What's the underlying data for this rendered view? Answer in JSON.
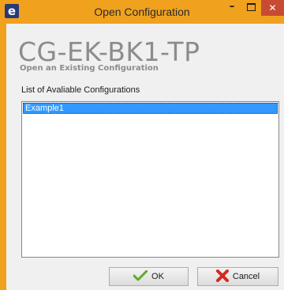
{
  "window": {
    "title": "Open Configuration",
    "app_icon": "e",
    "controls": {
      "minimize": "–",
      "close": "✕"
    }
  },
  "header": {
    "product": "CG-EK-BK1-TP",
    "subtitle": "Open an Existing Configuration"
  },
  "list": {
    "label": "List of Avaliable Configurations",
    "items": [
      "Example1"
    ],
    "selected_index": 0
  },
  "buttons": {
    "ok": {
      "label": "OK",
      "icon": "checkmark-icon"
    },
    "cancel": {
      "label": "Cancel",
      "icon": "red-x-icon"
    }
  },
  "colors": {
    "titlebar": "#f0a11e",
    "close_button": "#c74a32",
    "selection": "#3399ff"
  }
}
